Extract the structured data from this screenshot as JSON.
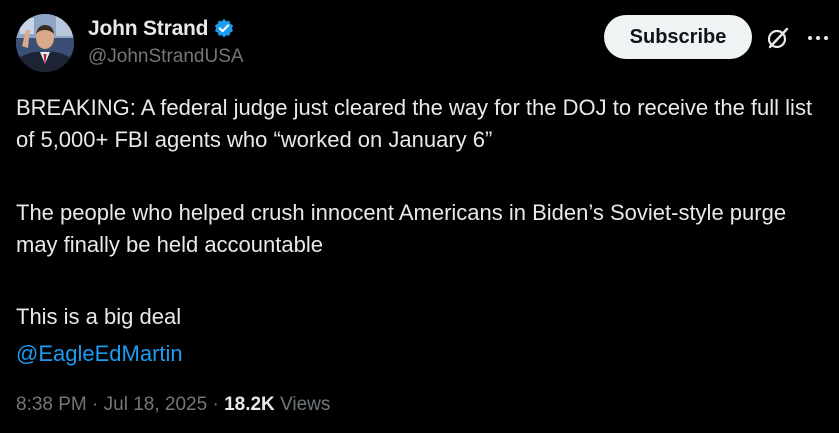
{
  "author": {
    "display_name": "John Strand",
    "handle": "@JohnStrandUSA",
    "verified": true
  },
  "actions": {
    "subscribe_label": "Subscribe",
    "grok_icon": "grok-slash-icon",
    "more_icon": "ellipsis-icon"
  },
  "tweet": {
    "paragraph_1": "BREAKING: A federal judge just cleared the way for the DOJ to receive the full list of 5,000+ FBI agents who “worked on January 6”",
    "paragraph_2": "The people who helped crush innocent Americans in Biden’s Soviet-style purge may finally be held accountable",
    "paragraph_3": "This is a big deal",
    "mention": "@EagleEdMartin"
  },
  "meta": {
    "time": "8:38 PM",
    "separator": "·",
    "date": "Jul 18, 2025",
    "views_count": "18.2K",
    "views_label": "Views"
  },
  "colors": {
    "background": "#000000",
    "text": "#e7e9ea",
    "secondary": "#71767b",
    "link": "#1d9bf0",
    "verified_badge": "#1d9bf0",
    "button_bg": "#eff3f4"
  }
}
